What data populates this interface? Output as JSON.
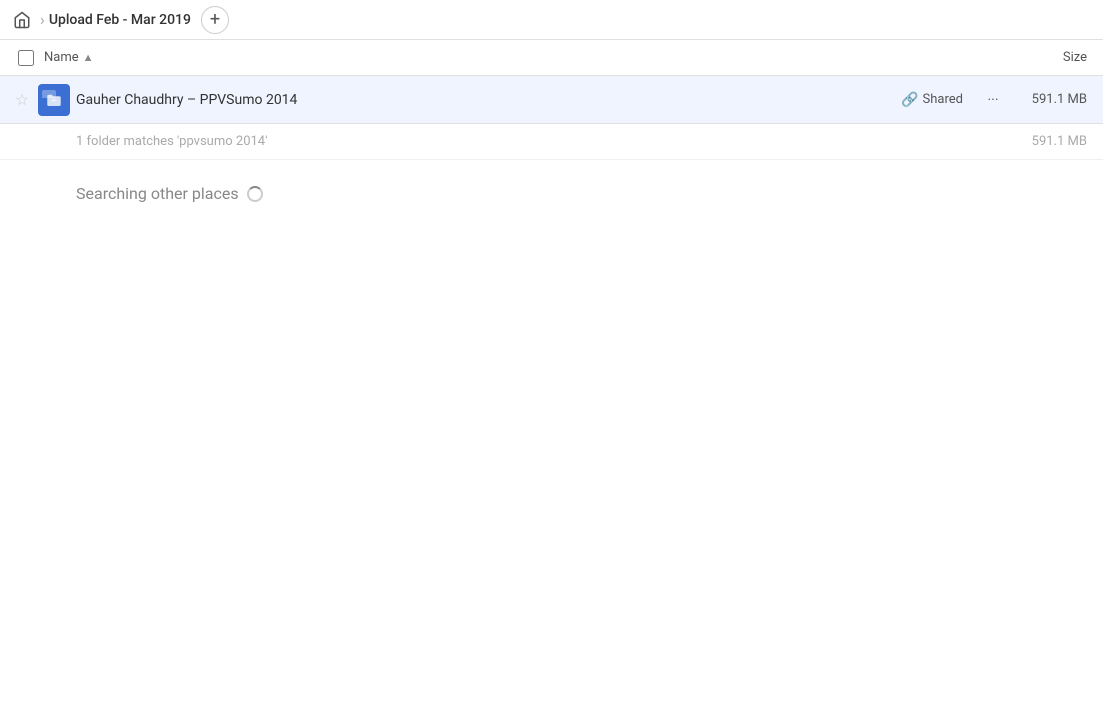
{
  "topbar": {
    "home_icon": "home",
    "separator": "›",
    "title": "Upload Feb - Mar 2019",
    "add_button_label": "+"
  },
  "columns": {
    "name_label": "Name",
    "sort_indicator": "▲",
    "size_label": "Size"
  },
  "file_row": {
    "name": "Gauher Chaudhry – PPVSumo 2014",
    "shared_label": "Shared",
    "size": "591.1 MB",
    "more_icon": "•••"
  },
  "summary": {
    "text": "1 folder matches 'ppvsumo 2014'",
    "size": "591.1 MB"
  },
  "searching": {
    "text": "Searching other places"
  }
}
